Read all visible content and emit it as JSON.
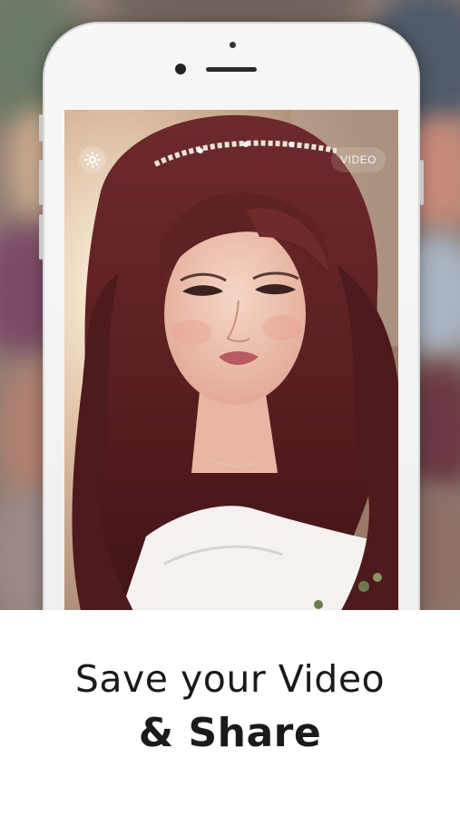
{
  "camera_screen": {
    "settings_icon": "gear-icon",
    "video_button_label": "VIDEO",
    "preview_description_icon": "photo-preview"
  },
  "caption": {
    "line1": "Save your Video",
    "line2": "& Share"
  },
  "colors": {
    "caption_text": "#1a1a1a",
    "panel_background": "#ffffff",
    "hair": "#5a1f22",
    "skin": "#f0c8b6"
  }
}
